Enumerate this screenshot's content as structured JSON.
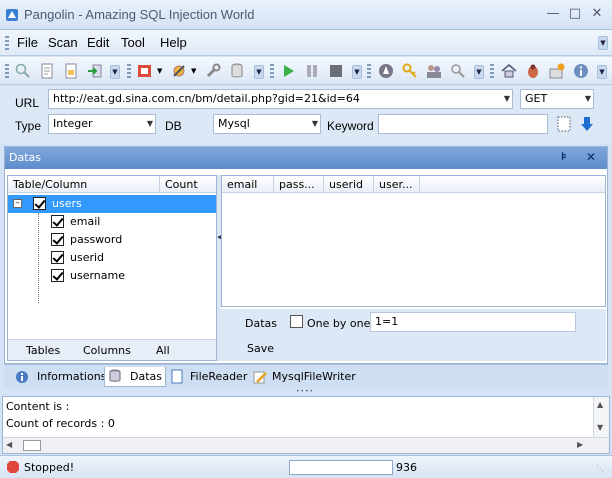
{
  "window": {
    "title": "Pangolin - Amazing SQL Injection World"
  },
  "menu": {
    "file": "File",
    "scan": "Scan",
    "edit": "Edit",
    "tool": "Tool",
    "help": "Help"
  },
  "form": {
    "url_label": "URL",
    "url_value": "http://eat.gd.sina.com.cn/bm/detail.php?gid=21&id=64",
    "method": "GET",
    "type_label": "Type",
    "type_value": "Integer",
    "db_label": "DB",
    "db_value": "Mysql",
    "keyword_label": "Keyword",
    "keyword_value": ""
  },
  "datas_panel": {
    "title": "Datas",
    "tree_headers": {
      "table_column": "Table/Column",
      "count": "Count"
    },
    "tree": {
      "table": "users",
      "columns": [
        "email",
        "password",
        "userid",
        "username"
      ]
    },
    "tree_footer": {
      "tables": "Tables",
      "columns": "Columns",
      "all": "All"
    },
    "grid_headers": [
      "email",
      "pass...",
      "userid",
      "user..."
    ],
    "options": {
      "datas_label": "Datas",
      "one_by_one": "One by one",
      "condition": "1=1",
      "save": "Save"
    }
  },
  "tabs": [
    "Informations",
    "Datas",
    "FileReader",
    "MysqlFileWriter"
  ],
  "output": {
    "content": "Content is :",
    "count": "Count of records : 0"
  },
  "status": {
    "text": "Stopped!",
    "value": "936"
  },
  "colors": {
    "header_blue": "#5e8ccc",
    "selected_row": "#3399ff",
    "accent_blue": "#1f6fcf"
  }
}
